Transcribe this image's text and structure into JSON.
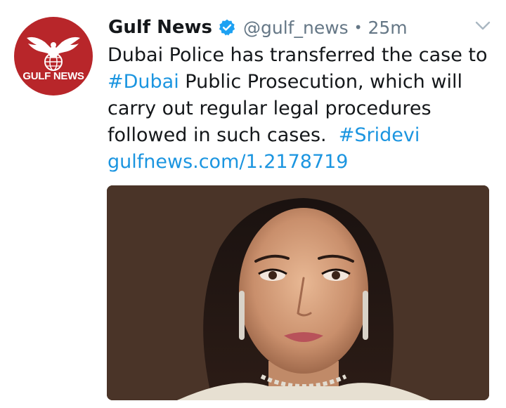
{
  "avatar": {
    "label": "GULF NEWS",
    "color": "#b8262a",
    "icon": "eagle-globe-logo"
  },
  "header": {
    "name": "Gulf News",
    "verified_icon": "verified-badge-icon",
    "handle": "@gulf_news",
    "separator": "•",
    "time": "25m",
    "menu_icon": "chevron-down-icon"
  },
  "tweet": {
    "line1": "Dubai Police has transferred the case to",
    "hashtag1": "#Dubai",
    "line2_rest": " Public Prosecution, which will",
    "line3": "carry out regular legal procedures",
    "line4": "followed in such cases.",
    "hashtag2": "#Sridevi",
    "link": "gulfnews.com/1.2178719"
  },
  "media": {
    "type": "photo"
  },
  "colors": {
    "link": "#1b95e0",
    "text": "#14171a",
    "muted": "#657786",
    "brand": "#b8262a"
  }
}
